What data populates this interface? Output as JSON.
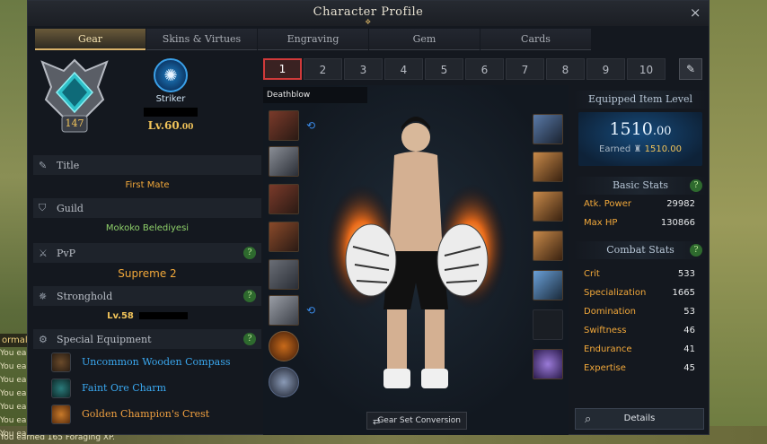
{
  "window": {
    "title": "Character Profile",
    "close": "×"
  },
  "tabs": [
    {
      "label": "Gear"
    },
    {
      "label": "Skins & Virtues"
    },
    {
      "label": "Engraving"
    },
    {
      "label": "Gem"
    },
    {
      "label": "Cards"
    }
  ],
  "character": {
    "roster_level": "147",
    "class_name": "Striker",
    "level_main": "Lv.60",
    "level_sub": ".00"
  },
  "sections": {
    "title": {
      "label": "Title",
      "value": "First Mate"
    },
    "guild": {
      "label": "Guild",
      "value": "Mokoko Belediyesi"
    },
    "pvp": {
      "label": "PvP",
      "value": "Supreme 2",
      "help": "?"
    },
    "stronghold": {
      "label": "Stronghold",
      "value": "Lv.58",
      "help": "?"
    },
    "special": {
      "label": "Special Equipment",
      "help": "?"
    }
  },
  "special_equipment": [
    {
      "label": "Uncommon Wooden Compass",
      "color": "#3aa8f0"
    },
    {
      "label": "Faint Ore Charm",
      "color": "#3aa8f0"
    },
    {
      "label": "Golden Champion's Crest",
      "color": "#f0a040"
    }
  ],
  "presets": [
    "1",
    "2",
    "3",
    "4",
    "5",
    "6",
    "7",
    "8",
    "9",
    "10"
  ],
  "active_preset": "1",
  "build_label": "Deathblow",
  "gear_set_button": "Gear Set Conversion",
  "item_level": {
    "header": "Equipped Item Level",
    "main": "1510",
    "decimal": ".00",
    "earned_label": "Earned",
    "earned_value": "1510.00"
  },
  "basic_stats": {
    "header": "Basic Stats",
    "help": "?",
    "rows": [
      {
        "k": "Atk. Power",
        "v": "29982"
      },
      {
        "k": "Max HP",
        "v": "130866"
      }
    ]
  },
  "combat_stats": {
    "header": "Combat Stats",
    "help": "?",
    "rows": [
      {
        "k": "Crit",
        "v": "533"
      },
      {
        "k": "Specialization",
        "v": "1665"
      },
      {
        "k": "Domination",
        "v": "53"
      },
      {
        "k": "Swiftness",
        "v": "46"
      },
      {
        "k": "Endurance",
        "v": "41"
      },
      {
        "k": "Expertise",
        "v": "45"
      }
    ]
  },
  "details_button": "Details",
  "chat": {
    "title": "ormal",
    "lines": [
      "You ea",
      "You ea",
      "You ea",
      "You ea",
      "You ea",
      "You ea",
      "You ea"
    ],
    "bottom": "You earned 165 Foraging XP."
  }
}
